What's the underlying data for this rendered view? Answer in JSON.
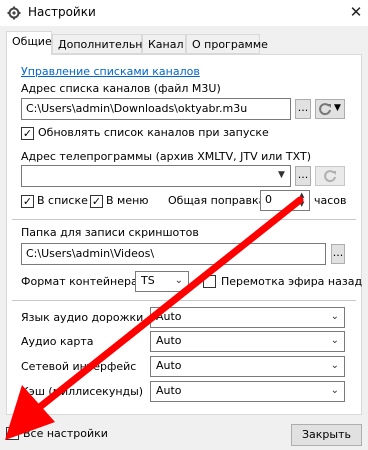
{
  "window": {
    "title": "Настройки",
    "close_glyph": "✕",
    "icon": "gear-icon"
  },
  "tabs": [
    {
      "label": "Общие",
      "active": true
    },
    {
      "label": "Дополнительно",
      "active": false
    },
    {
      "label": "Канал",
      "active": false
    },
    {
      "label": "О программе",
      "active": false
    }
  ],
  "channels": {
    "manage_link": "Управление списками каналов",
    "address_label": "Адрес списка каналов (файл M3U)",
    "address_value": "C:\\Users\\admin\\Downloads\\oktyabr.m3u",
    "browse_label": "...",
    "refresh_label": "Обновлять список каналов при запуске",
    "refresh_checked": true
  },
  "epg": {
    "address_label": "Адрес телепрограммы (архив XMLTV, JTV или TXT)",
    "address_value": "",
    "browse_label": "...",
    "in_list_label": "В списке",
    "in_list_checked": true,
    "in_menu_label": "В меню",
    "in_menu_checked": true,
    "correction_label": "Общая поправка",
    "correction_value": "0",
    "hours_label": "часов"
  },
  "screenshots": {
    "folder_label": "Папка для записи скриншотов",
    "folder_value": "C:\\Users\\admin\\Videos\\",
    "browse_label": "..."
  },
  "container": {
    "label": "Формат контейнера",
    "value": "TS",
    "rewind_label": "Перемотка эфира назад",
    "rewind_checked": false
  },
  "settings_rows": [
    {
      "label": "Язык аудио дорожки",
      "value": "Auto"
    },
    {
      "label": "Аудио карта",
      "value": "Auto"
    },
    {
      "label": "Сетевой интерфейс",
      "value": "Auto"
    },
    {
      "label": "Кэш (миллисекунды)",
      "value": "Auto"
    }
  ],
  "footer": {
    "all_settings_label": "Все настройки",
    "all_settings_checked": true,
    "close_label": "Закрыть"
  },
  "colors": {
    "arrow": "#ff0000",
    "link": "#0066cc"
  }
}
